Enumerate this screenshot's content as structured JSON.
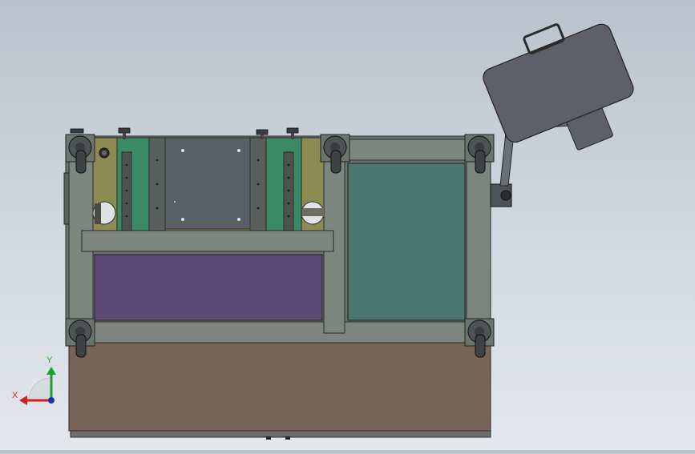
{
  "triad": {
    "x_label": "X",
    "y_label": "Y",
    "x_color": "#d22020",
    "y_color": "#1e9e3a",
    "z_color": "#2233aa"
  },
  "colors": {
    "background_top": "#b9c2cd",
    "background_bottom": "#e4e8ec",
    "frame": "#6b756e",
    "frame_light": "#7c867f",
    "olive_panel": "#8c8b52",
    "green_block": "#3a8a66",
    "center_plate": "#5b6068",
    "purple_panel": "#5c4a78",
    "teal_panel": "#4a7871",
    "brown_base": "#786358",
    "monitor": "#5d6069",
    "caster": "#4e5356"
  }
}
